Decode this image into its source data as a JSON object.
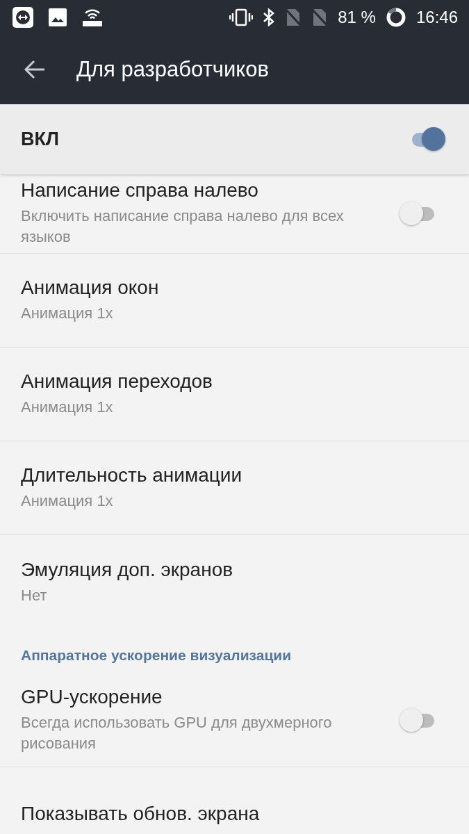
{
  "status_bar": {
    "battery": "81 %",
    "time": "16:46"
  },
  "toolbar": {
    "title": "Для разработчиков"
  },
  "master": {
    "label": "ВКЛ",
    "on": true
  },
  "items": [
    {
      "kind": "switch",
      "title": "Написание справа налево",
      "summary": "Включить написание справа налево для всех языков",
      "on": false
    },
    {
      "kind": "value",
      "title": "Анимация окон",
      "summary": "Анимация 1x"
    },
    {
      "kind": "value",
      "title": "Анимация переходов",
      "summary": "Анимация 1x"
    },
    {
      "kind": "value",
      "title": "Длительность анимации",
      "summary": "Анимация 1x"
    },
    {
      "kind": "value",
      "title": "Эмуляция доп. экранов",
      "summary": "Нет"
    },
    {
      "kind": "header",
      "title": "Аппаратное ускорение визуализации"
    },
    {
      "kind": "switch",
      "title": "GPU-ускорение",
      "summary": "Всегда использовать GPU для двухмерного рисования",
      "on": false
    },
    {
      "kind": "value",
      "title": "Показывать обнов. экрана"
    }
  ]
}
